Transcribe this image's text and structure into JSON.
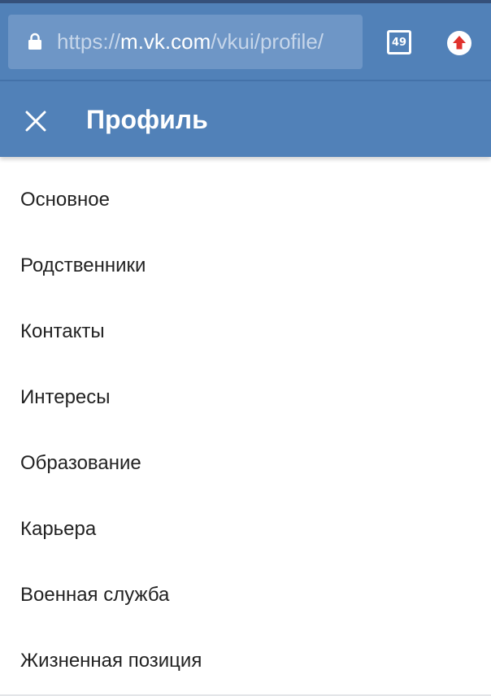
{
  "browser": {
    "url_scheme": "https://",
    "url_host": "m.vk.com",
    "url_path": "/vkui/profile/",
    "tab_count": "49",
    "icons": {
      "lock": "lock-icon",
      "tabs": "tabs-icon",
      "update": "update-icon"
    }
  },
  "header": {
    "title": "Профиль",
    "close_icon": "close-icon"
  },
  "menu": {
    "items": [
      {
        "label": "Основное"
      },
      {
        "label": "Родственники"
      },
      {
        "label": "Контакты"
      },
      {
        "label": "Интересы"
      },
      {
        "label": "Образование"
      },
      {
        "label": "Карьера"
      },
      {
        "label": "Военная служба"
      },
      {
        "label": "Жизненная позиция"
      }
    ]
  },
  "colors": {
    "header_bg": "#5181b8",
    "url_box_bg": "#6e96c6",
    "update_icon_bg": "#ffffff",
    "update_arrow": "#e0322d",
    "text": "#222222"
  }
}
